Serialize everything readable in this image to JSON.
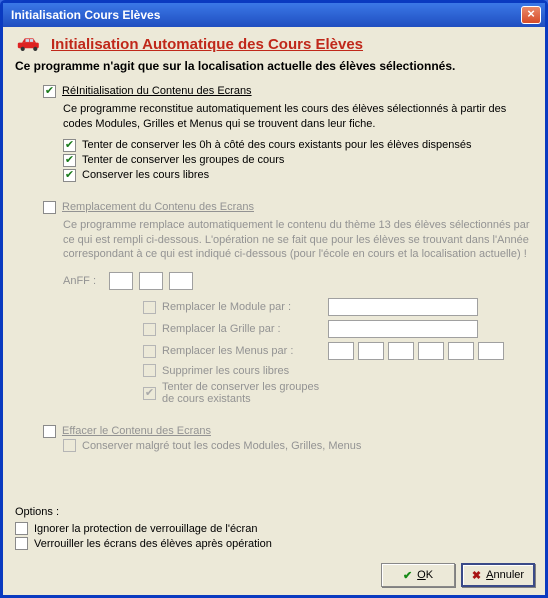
{
  "window": {
    "title": "Initialisation Cours Elèves"
  },
  "header": {
    "title": "Initialisation Automatique des Cours Elèves",
    "subtitle": "Ce programme n'agit que sur la localisation actuelle des élèves sélectionnés."
  },
  "section1": {
    "title": "RéInitialisation du Contenu des Ecrans",
    "desc": "Ce programme reconstitue automatiquement les cours des élèves sélectionnés à partir des codes Modules, Grilles et Menus qui se trouvent dans leur fiche.",
    "opt1": "Tenter de conserver les 0h à côté des cours existants pour les élèves dispensés",
    "opt2": "Tenter de conserver les groupes de cours",
    "opt3": "Conserver les cours libres"
  },
  "section2": {
    "title": "Remplacement du Contenu des Ecrans",
    "desc": "Ce programme remplace automatiquement le contenu du thème 13 des élèves sélectionnés par ce qui est rempli ci-dessous. L'opération ne se fait que pour les élèves se trouvant dans l'Année correspondant à ce qui est indiqué ci-dessous (pour l'école en cours et la localisation actuelle) !",
    "anff_label": "AnFF :",
    "rep_module": "Remplacer le Module par :",
    "rep_grille": "Remplacer la Grille par :",
    "rep_menus": "Remplacer les Menus par :",
    "sup_libres": "Supprimer les cours libres",
    "tenter_groupes": "Tenter de conserver les groupes de cours existants"
  },
  "section3": {
    "title": "Effacer le Contenu des Ecrans",
    "opt1": "Conserver malgré tout les codes Modules, Grilles, Menus"
  },
  "options": {
    "label": "Options :",
    "opt1": "Ignorer la protection de verrouillage de l'écran",
    "opt2": "Verrouiller les écrans des élèves après opération"
  },
  "buttons": {
    "ok_first": "O",
    "ok_rest": "K",
    "cancel_first": "A",
    "cancel_rest": "nnuler"
  }
}
